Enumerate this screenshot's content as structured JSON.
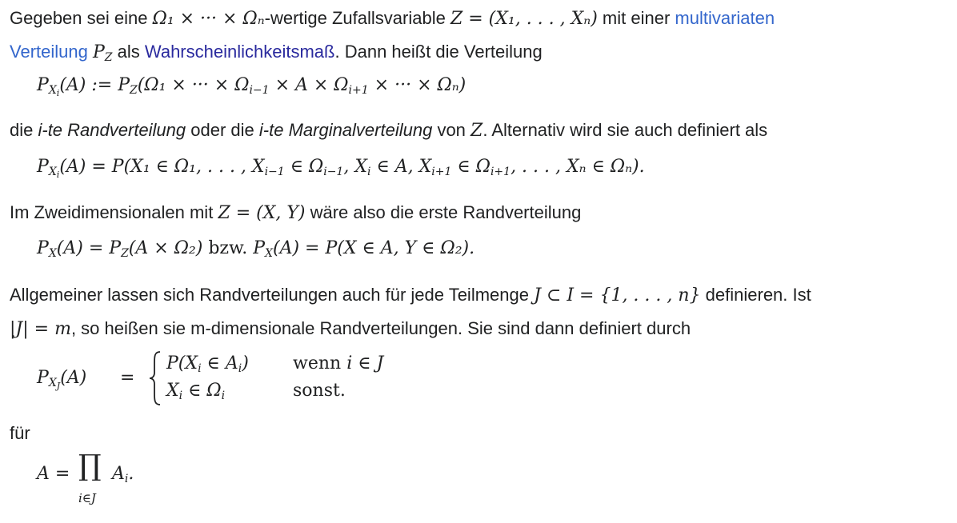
{
  "p1": {
    "t1": "Gegeben sei eine ",
    "m1": "Ω₁ × ··· × Ωₙ",
    "t2": "-wertige Zufallsvariable ",
    "m2": "Z = (X₁, . . . , Xₙ)",
    "t3": " mit einer ",
    "link1": "multivariaten",
    "link2": "Verteilung",
    "m3": "P",
    "m3sub": "Z",
    "t4": " als ",
    "link3": "Wahrscheinlichkeitsmaß",
    "t5": ". Dann heißt die Verteilung"
  },
  "eq1": "P",
  "eq1_sub": "X",
  "eq1_subsub": "i",
  "eq1_rest": "(A) := P",
  "eq1_sub2": "Z",
  "eq1_rest2": "(Ω₁ × ··· × Ω",
  "eq1_sub3": "i−1",
  "eq1_rest3": " × A × Ω",
  "eq1_sub4": "i+1",
  "eq1_rest4": " × ··· × Ωₙ)",
  "p2": {
    "t1": "die ",
    "em1": "i-te Randverteilung",
    "t2": " oder die ",
    "em2": "i-te Marginalverteilung",
    "t3": " von ",
    "m1": "Z",
    "t4": ". Alternativ wird sie auch definiert als"
  },
  "eq2": "P",
  "eq2_sub": "X",
  "eq2_subsub": "i",
  "eq2_rest": "(A) = P(X₁ ∈ Ω₁, . . . , X",
  "eq2_s1": "i−1",
  "eq2_r1": " ∈ Ω",
  "eq2_s2": "i−1",
  "eq2_r2": ", X",
  "eq2_s3": "i",
  "eq2_r3": " ∈ A, X",
  "eq2_s4": "i+1",
  "eq2_r4": " ∈ Ω",
  "eq2_s5": "i+1",
  "eq2_r5": ", . . . , Xₙ ∈ Ωₙ).",
  "p3": {
    "t1": "Im Zweidimensionalen mit ",
    "m1": "Z = (X, Y)",
    "t2": " wäre also die erste Randverteilung"
  },
  "eq3": "P",
  "eq3_sub": "X",
  "eq3_rest": "(A) = P",
  "eq3_sub2": "Z",
  "eq3_rest2": "(A × Ω₂)",
  "eq3_bzw": " bzw. ",
  "eq3_rest3": "P",
  "eq3_sub3": "X",
  "eq3_rest4": "(A) = P(X ∈ A, Y ∈ Ω₂).",
  "p4": {
    "t1": "Allgemeiner lassen sich Randverteilungen auch für jede Teilmenge ",
    "m1": "J ⊂ I = {1, . . . , n}",
    "t2": " definieren. Ist",
    "m2": "|J| = m",
    "t3": ", so heißen sie m-dimensionale Randverteilungen. Sie sind dann definiert durch"
  },
  "eq4": {
    "lhs": "P",
    "lhs_sub": "X",
    "lhs_subsub": "J",
    "lhs_rest": "(A)",
    "eq": "=",
    "row1_a": "P(X",
    "row1_s": "i",
    "row1_b": " ∈ A",
    "row1_s2": "i",
    "row1_c": ")",
    "row1_cond": "wenn ",
    "row1_cond_m": "i ∈ J",
    "row2_a": "X",
    "row2_s": "i",
    "row2_b": " ∈ Ω",
    "row2_s2": "i",
    "row2_cond": "sonst."
  },
  "p5": "für",
  "eq5": {
    "lhs": "A =",
    "prod": "∏",
    "sub": "i∈J",
    "rhs": "A",
    "rhs_sub": "i",
    "end": "."
  },
  "colors": {
    "link": "#3366cc",
    "link_visited": "#2a2a9e",
    "text": "#202122"
  }
}
